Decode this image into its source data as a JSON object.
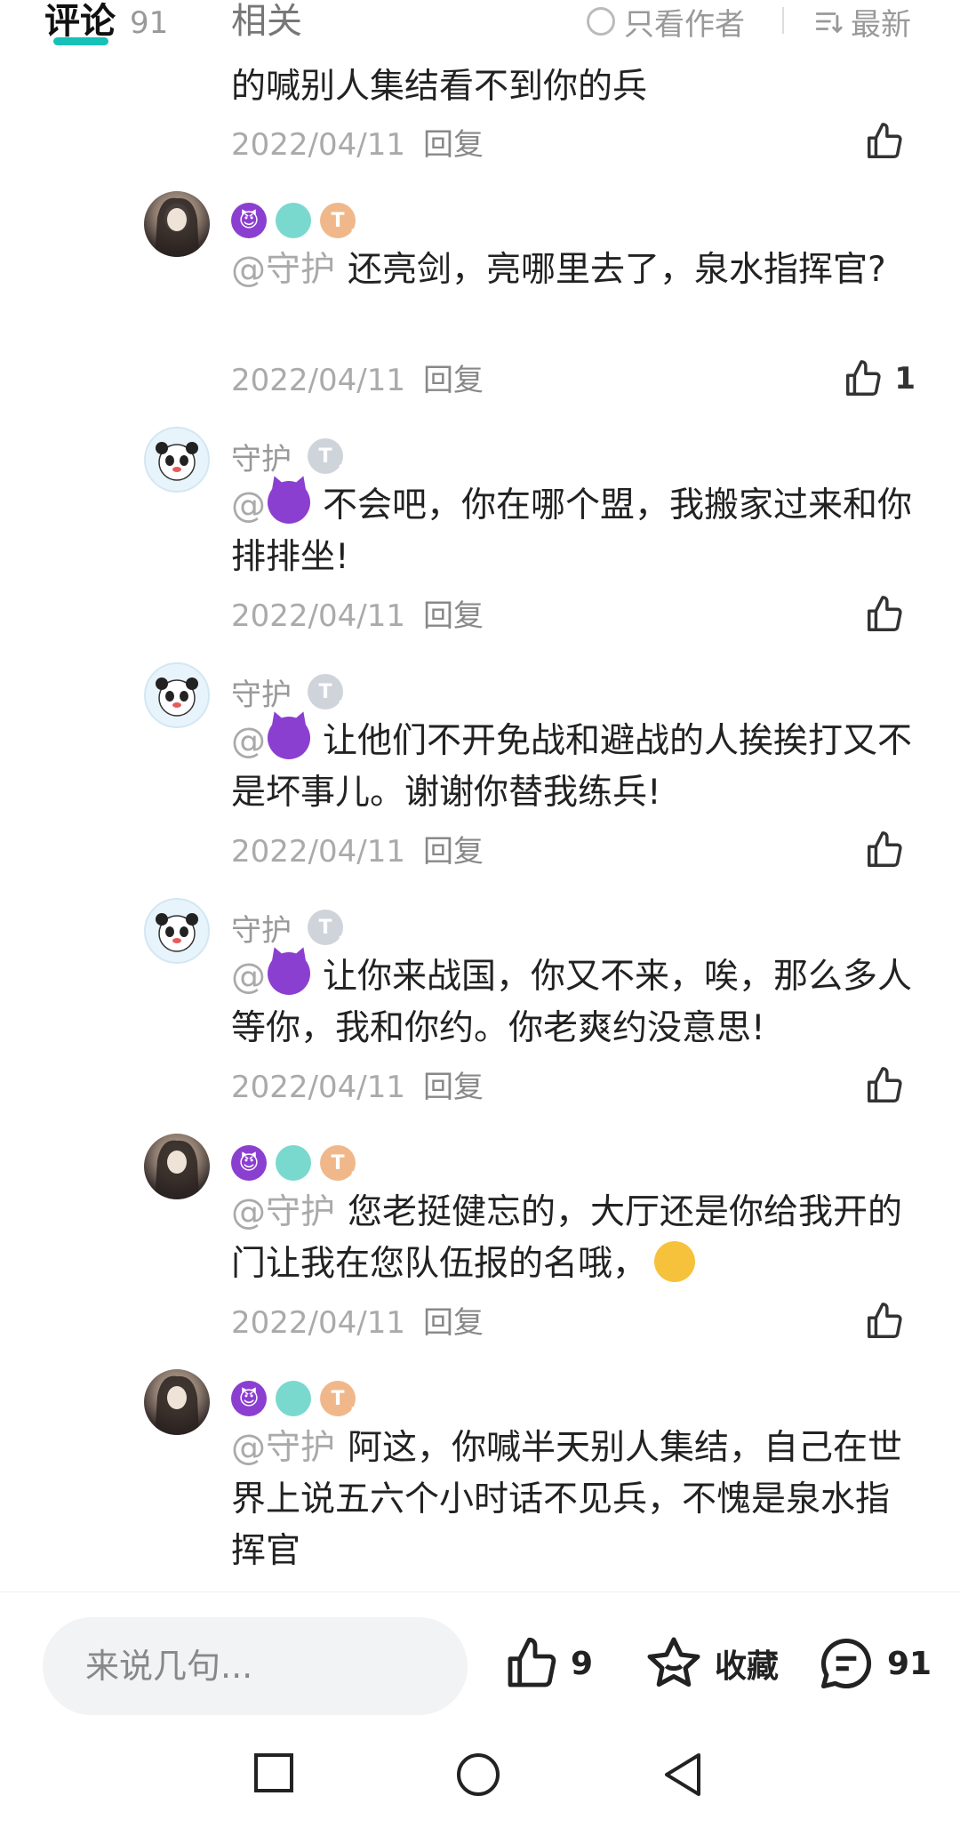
{
  "header": {
    "tab_comments": "评论",
    "tab_comments_count": "91",
    "tab_related": "相关",
    "author_only": "只看作者",
    "sort": "最新"
  },
  "partial_comment": "的喊别人集结看不到你的兵",
  "replies": [
    {
      "avatar": "girl-avatar",
      "name": "",
      "badges": [
        "devil-badge",
        "leaf-badge",
        "t5-badge"
      ],
      "mention": "@守护",
      "text": "还亮剑，亮哪里去了，泉水指挥官?",
      "date": "2022/04/11",
      "reply_label": "回复",
      "likes": "1"
    },
    {
      "avatar": "panda-avatar",
      "name": "守护",
      "badges": [
        "t3-badge"
      ],
      "mention": "@",
      "text": "不会吧，你在哪个盟，我搬家过来和你排排坐!",
      "date": "2022/04/11",
      "reply_label": "回复",
      "likes": ""
    },
    {
      "avatar": "panda-avatar",
      "name": "守护",
      "badges": [
        "t3-badge"
      ],
      "mention": "@",
      "text": "让他们不开免战和避战的人挨挨打又不是坏事儿。谢谢你替我练兵!",
      "date": "2022/04/11",
      "reply_label": "回复",
      "likes": ""
    },
    {
      "avatar": "panda-avatar",
      "name": "守护",
      "badges": [
        "t3-badge"
      ],
      "mention": "@",
      "text": "让你来战国，你又不来，唉，那么多人等你，我和你约。你老爽约没意思!",
      "date": "2022/04/11",
      "reply_label": "回复",
      "likes": ""
    },
    {
      "avatar": "girl-avatar",
      "name": "",
      "badges": [
        "devil-badge",
        "leaf-badge",
        "t5-badge"
      ],
      "mention": "@守护",
      "text": "您老挺健忘的，大厅还是你给我开的门让我在您队伍报的名哦，",
      "text_suffix": "，",
      "date": "2022/04/11",
      "reply_label": "回复",
      "likes": ""
    },
    {
      "avatar": "girl-avatar",
      "name": "",
      "badges": [
        "devil-badge",
        "leaf-badge",
        "t5-badge"
      ],
      "mention": "@守护",
      "text": "阿这，你喊半天别人集结，自己在世界上说五六个小时话不见兵，不愧是泉水指挥官",
      "date": "",
      "reply_label": "",
      "likes": ""
    }
  ],
  "bottom_bar": {
    "input_placeholder": "来说几句...",
    "like_count": "9",
    "favorite_label": "收藏",
    "comment_count": "91"
  },
  "colors": {
    "accent": "#16c1b8",
    "muted_text": "#aaaaaa",
    "devil_purple": "#8b3fd0"
  }
}
